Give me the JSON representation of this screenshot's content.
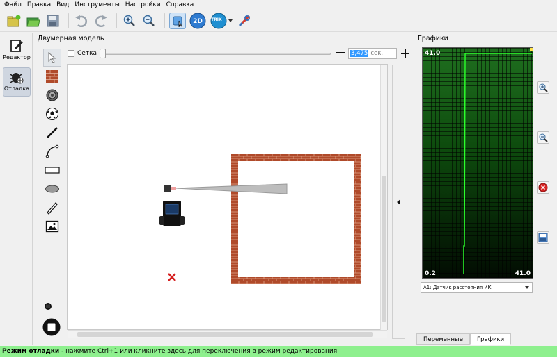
{
  "menu": [
    "Файл",
    "Правка",
    "Вид",
    "Инструменты",
    "Настройки",
    "Справка"
  ],
  "toolbar": {
    "icons": [
      "new-file-icon",
      "open-folder-icon",
      "save-icon",
      "undo-icon",
      "redo-icon",
      "zoom-in-icon",
      "zoom-out-icon",
      "debug-view-icon",
      "2d-model-icon",
      "trik-robot-icon",
      "tools-icon"
    ],
    "btn_2d": "2D",
    "btn_trik": "TRIK"
  },
  "modes": {
    "editor": "Редактор",
    "debug": "Отладка"
  },
  "model2d": {
    "title": "Двумерная модель",
    "grid_label": "Сетка",
    "time_value": "3,475",
    "time_unit": "сек."
  },
  "graphs": {
    "title": "Графики",
    "top_left": "41.0",
    "bottom_left": "0.2",
    "bottom_right": "41.0",
    "sensor": "A1: Датчик расстояния ИК",
    "tabs": [
      "Переменные",
      "Графики"
    ]
  },
  "status": {
    "mode": "Режим отладки",
    "hint": " - нажмите Ctrl+1 или кликните здесь для переключения в режим редактирования"
  },
  "colors": {
    "status_bg": "#8ef08e",
    "graph_line": "#2bff2b",
    "wall": "#b04a2a"
  }
}
